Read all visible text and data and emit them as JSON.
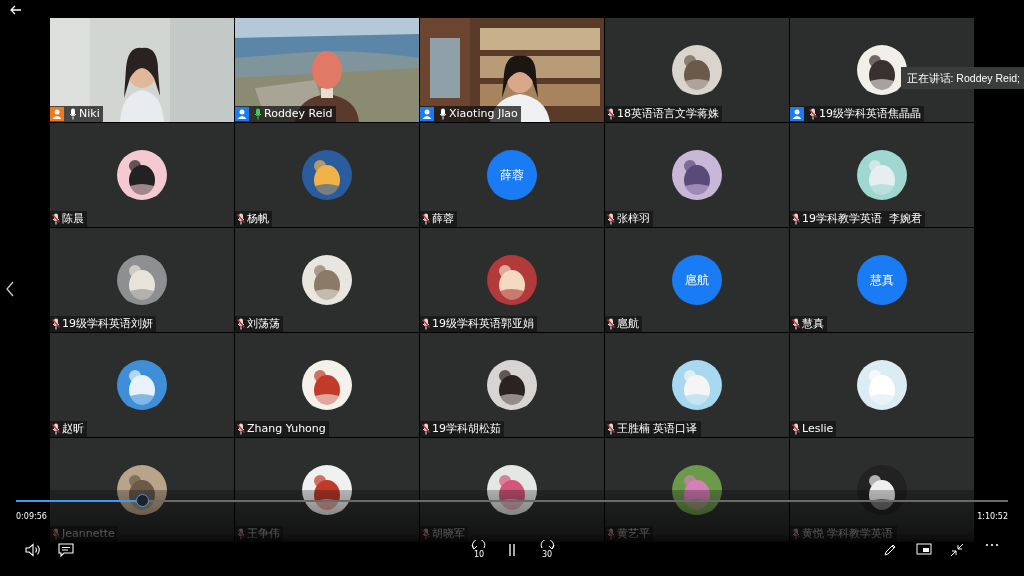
{
  "speaker_tooltip": "正在讲话: Roddey Reid;",
  "tiles": [
    {
      "name": "Niki",
      "kind": "video",
      "color": "#f07a1a",
      "muted": false,
      "speaking": false
    },
    {
      "name": "Roddey Reid",
      "kind": "video",
      "color": "#1a7cf5",
      "muted": false,
      "speaking": true
    },
    {
      "name": "Xiaoting JIao",
      "kind": "video",
      "color": "#1a7cf5",
      "muted": false,
      "speaking": false
    },
    {
      "name": "18英语语言文学蒋姝",
      "kind": "avatar",
      "muted": true,
      "speaking": false
    },
    {
      "name": "19级学科英语焦晶晶",
      "kind": "avatar",
      "color": "#1a7cf5",
      "muted": true,
      "speaking": false
    },
    {
      "name": "陈晨",
      "kind": "avatar",
      "muted": true,
      "speaking": false
    },
    {
      "name": "杨帆",
      "kind": "avatar",
      "muted": true,
      "speaking": false
    },
    {
      "name": "薛蓉",
      "kind": "initials",
      "initials": "薛蓉",
      "muted": true,
      "speaking": false
    },
    {
      "name": "张梓羽",
      "kind": "avatar",
      "muted": true,
      "speaking": false
    },
    {
      "name": "19学科教学英语  李婉君",
      "kind": "avatar",
      "muted": true,
      "speaking": false
    },
    {
      "name": "19级学科英语刘妍",
      "kind": "avatar",
      "muted": true,
      "speaking": false
    },
    {
      "name": "刘荡荡",
      "kind": "avatar",
      "muted": true,
      "speaking": false
    },
    {
      "name": "19级学科英语郭亚娟",
      "kind": "avatar",
      "muted": true,
      "speaking": false
    },
    {
      "name": "扈航",
      "kind": "initials",
      "initials": "扈航",
      "muted": true,
      "speaking": false
    },
    {
      "name": "慧真",
      "kind": "initials",
      "initials": "慧真",
      "muted": true,
      "speaking": false
    },
    {
      "name": "赵昕",
      "kind": "avatar",
      "muted": true,
      "speaking": false
    },
    {
      "name": "Zhang Yuhong",
      "kind": "avatar",
      "muted": true,
      "speaking": false
    },
    {
      "name": "19学科胡松茹",
      "kind": "avatar",
      "muted": true,
      "speaking": false
    },
    {
      "name": "王胜楠 英语口译",
      "kind": "avatar",
      "muted": true,
      "speaking": false
    },
    {
      "name": "Leslie",
      "kind": "avatar",
      "muted": true,
      "speaking": false
    },
    {
      "name": "Jeannette",
      "kind": "avatar",
      "muted": true,
      "speaking": false
    },
    {
      "name": "王争伟",
      "kind": "avatar",
      "muted": true,
      "speaking": false
    },
    {
      "name": "胡晓军",
      "kind": "avatar",
      "muted": true,
      "speaking": false
    },
    {
      "name": "黄艺平",
      "kind": "avatar",
      "muted": true,
      "speaking": false
    },
    {
      "name": "黄悦 学科教学英语",
      "kind": "avatar",
      "muted": true,
      "speaking": false
    }
  ],
  "player": {
    "elapsed": "0:09:56",
    "duration": "1:10:52",
    "level": 0.128,
    "rewind_label": "10",
    "forward_label": "30"
  }
}
